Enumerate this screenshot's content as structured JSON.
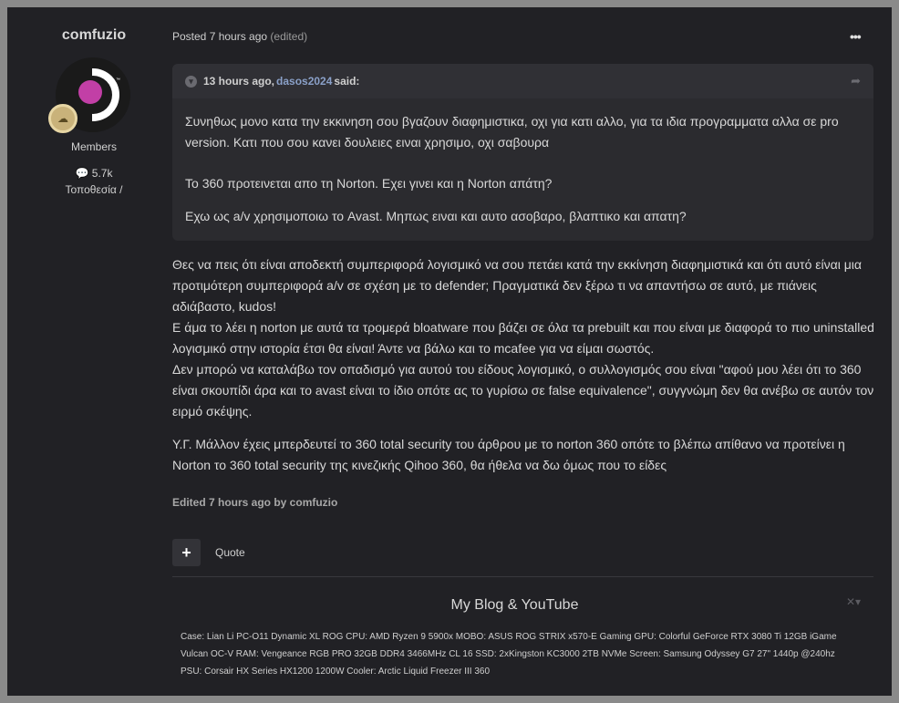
{
  "author": {
    "name": "comfuzio",
    "group": "Members",
    "posts": "5.7k",
    "location": "Τοποθεσία /"
  },
  "post": {
    "posted": "Posted 7 hours ago",
    "edited_tag": "(edited)"
  },
  "quote": {
    "time": "13 hours ago,",
    "user": "dasos2024",
    "said": "said:",
    "paragraphs": [
      "Συνηθως μονο κατα την εκκινηση σου βγαζουν διαφημιστικα, οχι για κατι αλλο, για τα ιδια προγραμματα αλλα σε pro version. Κατι που σου κανει δουλειες ειναι χρησιμο, οχι σαβουρα",
      "Το 360 προτεινεται απο τη Norton. Εχει γινει και η Norton απάτη?",
      "Εχω ως a/v χρησιμοποιω το Avast. Μηπως ειναι και αυτο ασοβαρο, βλαπτικο και απατη?"
    ]
  },
  "content": {
    "paragraphs": [
      "Θες να πεις ότι είναι αποδεκτή συμπεριφορά λογισμικό να σου πετάει κατά την εκκίνηση διαφημιστικά και ότι αυτό είναι μια προτιμότερη συμπεριφορά a/v σε σχέση με το defender; Πραγματικά δεν ξέρω τι να απαντήσω σε αυτό, με πιάνεις αδιάβαστο, kudos!",
      "Ε άμα το λέει η norton με αυτά τα τρομερά bloatware που βάζει σε όλα τα prebuilt και που είναι με διαφορά το πιο uninstalled λογισμικό στην ιστορία έτσι θα είναι! Άντε να βάλω και το mcafee για να είμαι σωστός.",
      "Δεν μπορώ να καταλάβω τον οπαδισμό για αυτού του είδους λογισμικό, ο συλλογισμός σου είναι \"αφού μου λέει ότι το 360 είναι σκουπίδι άρα και το avast είναι το ίδιο οπότε ας το γυρίσω σε false equivalence\", συγγνώμη δεν θα ανέβω σε αυτόν τον ειρμό σκέψης.",
      "Υ.Γ. Μάλλον έχεις μπερδευτεί το 360 total security του άρθρου με το norton 360 οπότε το βλέπω απίθανο να προτείνει η Norton το 360 total security της κινεζικής Qihoo 360, θα ήθελα να δω όμως που το είδες"
    ],
    "edited_by": "Edited 7 hours ago by comfuzio"
  },
  "actions": {
    "plus": "+",
    "quote": "Quote"
  },
  "signature": {
    "title": "My Blog & YouTube",
    "close": "✕▾",
    "text": "Case: Lian Li PC-O11 Dynamic XL ROG CPU: AMD Ryzen 9 5900x MOBO: ASUS ROG STRIX x570-E Gaming GPU: Colorful GeForce RTX 3080 Ti 12GB iGame Vulcan OC-V RAM: Vengeance RGB PRO 32GB DDR4 3466MHz CL 16 SSD: 2xKingston KC3000 2TB NVMe Screen: Samsung Odyssey G7 27\" 1440p @240hz PSU: Corsair HX Series HX1200 1200W Cooler: Arctic Liquid Freezer III 360"
  },
  "colors": {
    "background": "#212125",
    "quote_bg": "#2b2b2f",
    "link": "#8aa0c8",
    "avatar_accent": "#c23fa6"
  }
}
